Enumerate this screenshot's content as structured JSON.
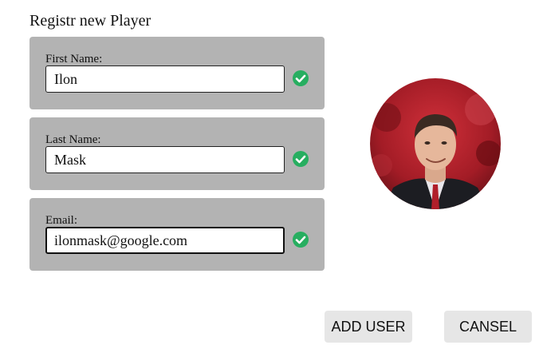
{
  "form": {
    "title": "Registr new Player",
    "fields": [
      {
        "label": "First Name:",
        "value": "Ilon",
        "valid": true
      },
      {
        "label": "Last Name:",
        "value": "Mask",
        "valid": true
      },
      {
        "label": "Email:",
        "value": "ilonmask@google.com",
        "valid": true
      }
    ]
  },
  "avatar": {
    "icon": "user-photo"
  },
  "actions": {
    "add_label": "ADD USER",
    "cancel_label": "CANSEL"
  },
  "colors": {
    "card_bg": "#b3b3b3",
    "check": "#27ae60",
    "button_bg": "#e6e6e6"
  }
}
